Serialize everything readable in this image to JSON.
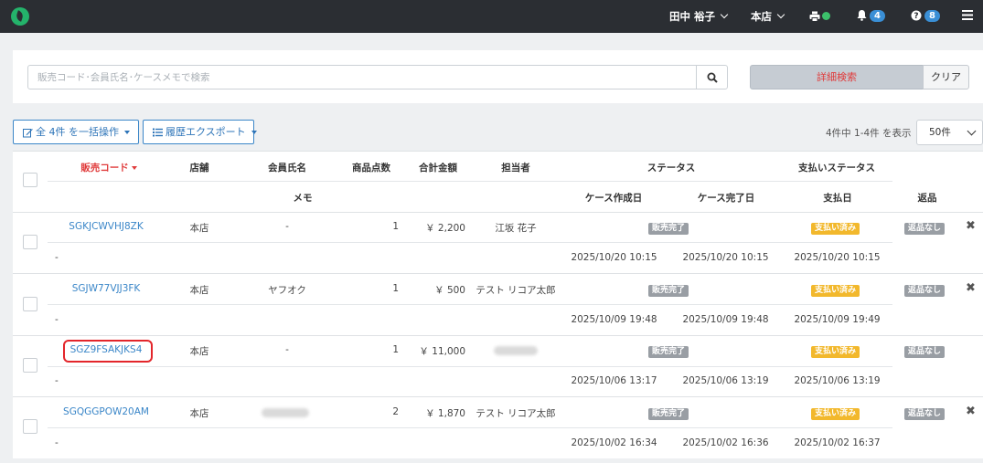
{
  "topbar": {
    "user_name": "田中 裕子",
    "store": "本店",
    "notifications_count": "4",
    "help_count": "8"
  },
  "search": {
    "placeholder": "販売コード･会員氏名･ケースメモで検索",
    "detail_label": "詳細検索",
    "clear_label": "クリア"
  },
  "actions": {
    "bulk_label": "全 4件 を一括操作",
    "export_label": "履歴エクスポート",
    "count_text": "4件中 1-4件 を表示",
    "per_page": "50件"
  },
  "columns": {
    "sales_code": "販売コード",
    "store": "店舗",
    "member": "会員氏名",
    "item_count": "商品点数",
    "total": "合計金額",
    "staff": "担当者",
    "status": "ステータス",
    "payment_status": "支払いステータス",
    "memo": "メモ",
    "case_created": "ケース作成日",
    "case_completed": "ケース完了日",
    "payment_date": "支払日",
    "returns": "返品"
  },
  "rows": [
    {
      "code": "SGKJCWVHJ8ZK",
      "store": "本店",
      "member": "-",
      "items": "1",
      "total": "￥ 2,200",
      "staff": "江坂 花子",
      "status": "販売完了",
      "payment": "支払い済み",
      "returns": "返品なし",
      "memo": "-",
      "created": "2025/10/20 10:15",
      "completed": "2025/10/20 10:15",
      "paid": "2025/10/20 10:15"
    },
    {
      "code": "SGJW77VJJ3FK",
      "store": "本店",
      "member": "ヤフオク",
      "items": "1",
      "total": "￥ 500",
      "staff": "テスト リコア太郎",
      "status": "販売完了",
      "payment": "支払い済み",
      "returns": "返品なし",
      "memo": "-",
      "created": "2025/10/09 19:48",
      "completed": "2025/10/09 19:48",
      "paid": "2025/10/09 19:49"
    },
    {
      "code": "SGZ9FSAKJKS4",
      "store": "本店",
      "member": "-",
      "items": "1",
      "total": "￥ 11,000",
      "staff": "",
      "status": "販売完了",
      "payment": "支払い済み",
      "returns": "返品なし",
      "memo": "-",
      "created": "2025/10/06 13:17",
      "completed": "2025/10/06 13:19",
      "paid": "2025/10/06 13:19"
    },
    {
      "code": "SGQGGPOW20AM",
      "store": "本店",
      "member": "",
      "items": "2",
      "total": "￥ 1,870",
      "staff": "テスト リコア太郎",
      "status": "販売完了",
      "payment": "支払い済み",
      "returns": "返品なし",
      "memo": "-",
      "created": "2025/10/02 16:34",
      "completed": "2025/10/02 16:36",
      "paid": "2025/10/02 16:37"
    }
  ],
  "colors": {
    "topbar": "#2b2e33",
    "link": "#3a86c8",
    "accent_red": "#e03b3b",
    "status_gray": "#999ea4",
    "payment_yellow": "#f2b82c",
    "badge_blue": "#3a8fd6"
  },
  "icons": {
    "logo": "leaf-logo-icon",
    "search": "search-icon",
    "printer": "printer-icon",
    "bell": "bell-icon",
    "help": "help-icon",
    "menu": "hamburger-menu-icon",
    "edit": "edit-icon",
    "list": "list-icon",
    "delete": "close-icon"
  }
}
